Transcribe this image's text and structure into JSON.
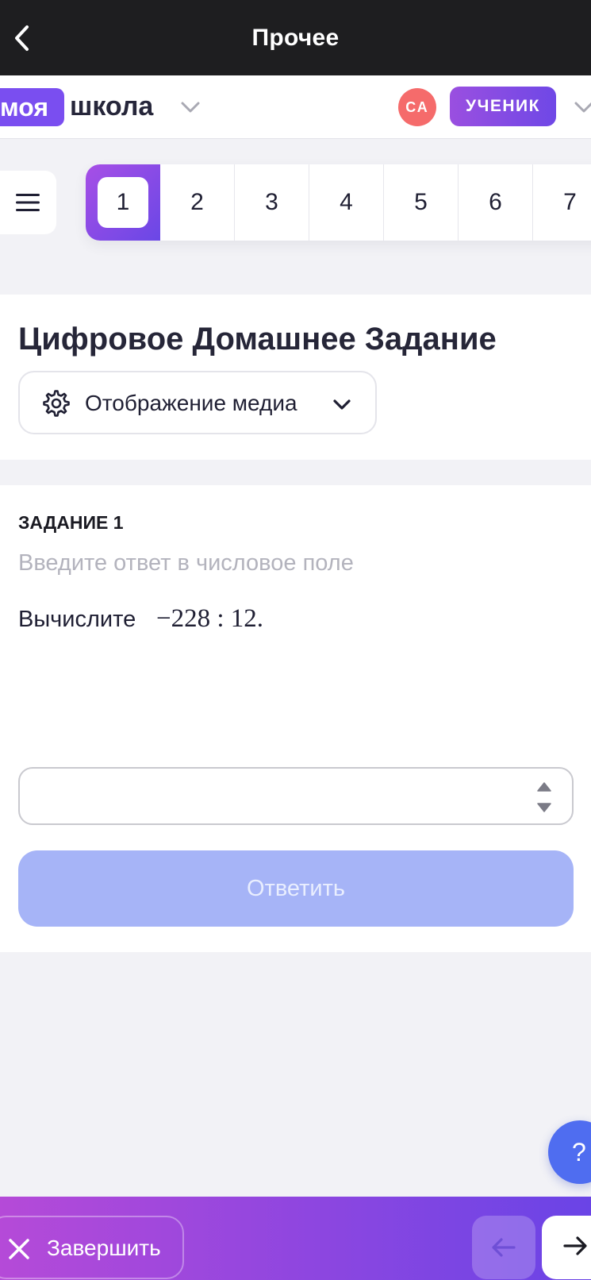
{
  "topbar": {
    "title": "Прочее",
    "back_icon": "chevron-left-icon"
  },
  "header": {
    "logo_part1": "моя",
    "logo_part2": "школа",
    "avatar_initials": "СА",
    "role": "УЧЕНИК"
  },
  "tasks": {
    "items": [
      "1",
      "2",
      "3",
      "4",
      "5",
      "6",
      "7"
    ],
    "active_index": 0
  },
  "card": {
    "title": "Цифровое Домашнее Задание",
    "media_label": "Отображение медиа"
  },
  "task": {
    "label": "ЗАДАНИЕ 1",
    "hint": "Введите ответ в числовое поле",
    "text": "Вычислите",
    "expression": "−228 : 12.",
    "input_value": "",
    "submit_label": "Ответить"
  },
  "help": {
    "label": "?"
  },
  "bottombar": {
    "finish_label": "Завершить"
  },
  "colors": {
    "accent": "#7a4ef0",
    "topbar": "#1e1e20",
    "avatar": "#f56b6b",
    "submit_disabled": "#a6b4f7",
    "help": "#4f6df0"
  }
}
